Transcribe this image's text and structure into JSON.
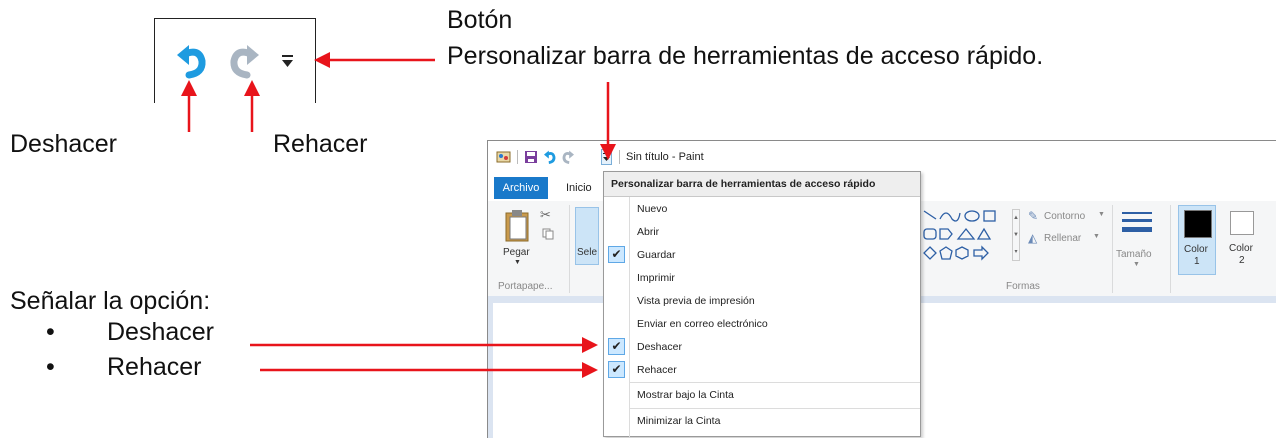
{
  "annotations": {
    "boton_title": "Botón",
    "boton_desc": "Personalizar barra de herramientas de acceso rápido.",
    "undo_label": "Deshacer",
    "redo_label": "Rehacer",
    "instruction_title": "Señalar la opción:",
    "bullet_items": [
      "Deshacer",
      "Rehacer"
    ],
    "bullet_char": "•"
  },
  "colors": {
    "arrow": "#e8141b",
    "undo_blue": "#1e9be0",
    "redo_gray": "#a9b5c2",
    "archivo_tab": "#1979ca",
    "check_bg": "#cce8ff"
  },
  "paint": {
    "window_title": "Sin título - Paint",
    "tabs": {
      "archivo": "Archivo",
      "inicio": "Inicio"
    },
    "ribbon": {
      "pegar": "Pegar",
      "portapapeles": "Portapape...",
      "sele": "Sele",
      "contorno": "Contorno",
      "rellenar": "Rellenar",
      "formas": "Formas",
      "tamano": "Tamaño",
      "color1_label": "Color",
      "color1_num": "1",
      "color2_label": "Color",
      "color2_num": "2"
    }
  },
  "menu": {
    "header": "Personalizar barra de herramientas de acceso rápido",
    "items": [
      {
        "label": "Nuevo",
        "checked": false
      },
      {
        "label": "Abrir",
        "checked": false
      },
      {
        "label": "Guardar",
        "checked": true
      },
      {
        "label": "Imprimir",
        "checked": false
      },
      {
        "label": "Vista previa de impresión",
        "checked": false
      },
      {
        "label": "Enviar en correo electrónico",
        "checked": false
      },
      {
        "label": "Deshacer",
        "checked": true
      },
      {
        "label": "Rehacer",
        "checked": true
      }
    ],
    "bottom_items": [
      "Mostrar bajo la Cinta",
      "Minimizar la Cinta"
    ],
    "check_glyph": "✔"
  }
}
